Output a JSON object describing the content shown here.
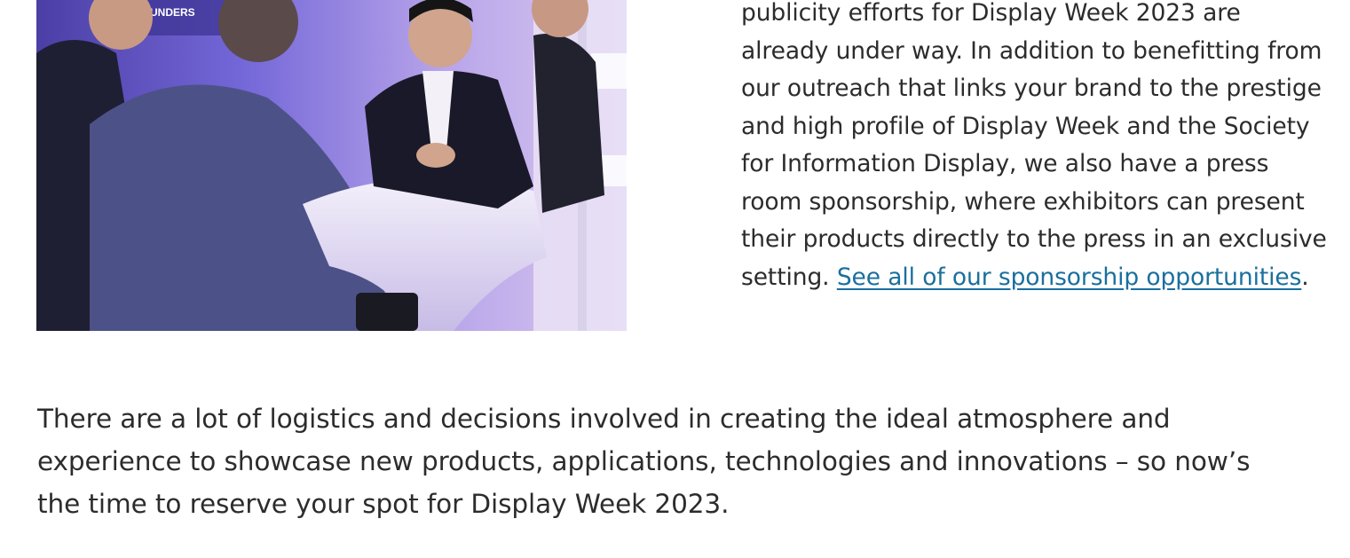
{
  "article": {
    "side_paragraph": "publicity efforts for Display Week 2023 are already under way. In addition to benefitting from our outreach that links your brand to the prestige and high profile of Display Week and the Society for Information Display, we also have a press room sponsorship, where exhibitors can present their products directly to the press in an exclusive setting. ",
    "link_text": "See all of our sponsorship opportunities",
    "link_suffix": ".",
    "body_paragraph": "There are a lot of logistics and decisions involved in creating the ideal atmosphere and experience to showcase new products, applications, technologies and innovations – so now’s the time to reserve your spot for Display Week 2023."
  },
  "photo": {
    "banner_text": "UNDERS",
    "colors": {
      "backdrop": "#6a5ccf",
      "suit_dark": "#1c1b2e",
      "suit_gray": "#4a5080",
      "table": "#e9e4f5",
      "skin": "#c99a86"
    }
  }
}
